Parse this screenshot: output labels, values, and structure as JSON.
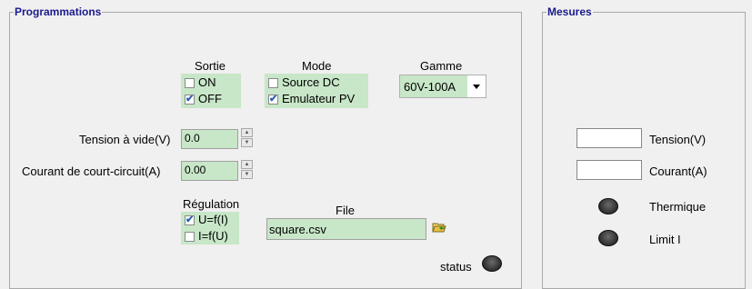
{
  "panels": {
    "programmations_title": "Programmations",
    "mesures_title": "Mesures"
  },
  "sortie": {
    "title": "Sortie",
    "on_label": "ON",
    "on_checked": false,
    "off_label": "OFF",
    "off_checked": true
  },
  "mode": {
    "title": "Mode",
    "source_dc_label": "Source DC",
    "source_dc_checked": false,
    "emulateur_label": "Emulateur PV",
    "emulateur_checked": true
  },
  "gamme": {
    "title": "Gamme",
    "selected": "60V-100A"
  },
  "tension_vide": {
    "label": "Tension à vide(V)",
    "value": "0.0"
  },
  "courant_cc": {
    "label": "Courant de court-circuit(A)",
    "value": "0.00"
  },
  "regulation": {
    "title": "Régulation",
    "u_label": "U=f(I)",
    "u_checked": true,
    "i_label": "I=f(U)",
    "i_checked": false
  },
  "file": {
    "title": "File",
    "value": "square.csv",
    "browse_icon": "folder-open-icon"
  },
  "status": {
    "label": "status"
  },
  "mesures": {
    "tension_label": "Tension(V)",
    "tension_value": "",
    "courant_label": "Courant(A)",
    "courant_value": "",
    "thermique_label": "Thermique",
    "limit_label": "Limit I"
  }
}
